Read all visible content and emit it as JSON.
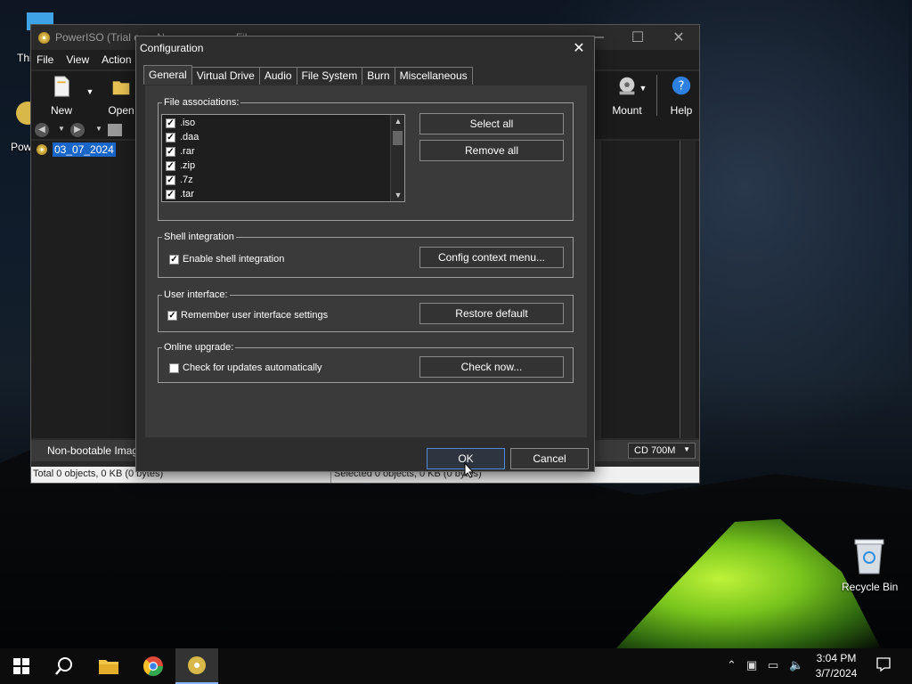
{
  "desktop": {
    "icons": [
      {
        "label": "Thi"
      },
      {
        "label": "Pow"
      },
      {
        "label": "Recycle Bin"
      }
    ]
  },
  "main_window": {
    "title": "PowerISO (Trial c",
    "title_suffix": "N",
    "title_suffix2": "Fil",
    "menu": [
      "File",
      "View",
      "Action"
    ],
    "toolbar": {
      "new": "New",
      "open": "Open",
      "mount": "Mount",
      "help": "Help"
    },
    "tree_item": "03_07_2024",
    "boot_label": "Non-bootable Image",
    "media_size": "CD 700M",
    "status_left": "Total 0 objects, 0 KB (0 bytes)",
    "status_right": "Selected 0 objects, 0 KB (0 bytes)"
  },
  "dialog": {
    "title": "Configuration",
    "tabs": [
      "General",
      "Virtual Drive",
      "Audio",
      "File System",
      "Burn",
      "Miscellaneous"
    ],
    "file_assoc": {
      "legend": "File associations:",
      "items": [
        ".iso",
        ".daa",
        ".rar",
        ".zip",
        ".7z",
        ".tar"
      ],
      "select_all": "Select all",
      "remove_all": "Remove all"
    },
    "shell": {
      "legend": "Shell integration",
      "checkbox": "Enable shell integration",
      "button": "Config context menu..."
    },
    "ui": {
      "legend": "User interface:",
      "checkbox": "Remember user interface settings",
      "button": "Restore default"
    },
    "upgrade": {
      "legend": "Online upgrade:",
      "checkbox": "Check for updates automatically",
      "button": "Check now..."
    },
    "ok": "OK",
    "cancel": "Cancel"
  },
  "taskbar": {
    "time": "3:04 PM",
    "date": "3/7/2024"
  },
  "colors": {
    "accent": "#4f8bd6",
    "selection": "#1a66c8"
  }
}
